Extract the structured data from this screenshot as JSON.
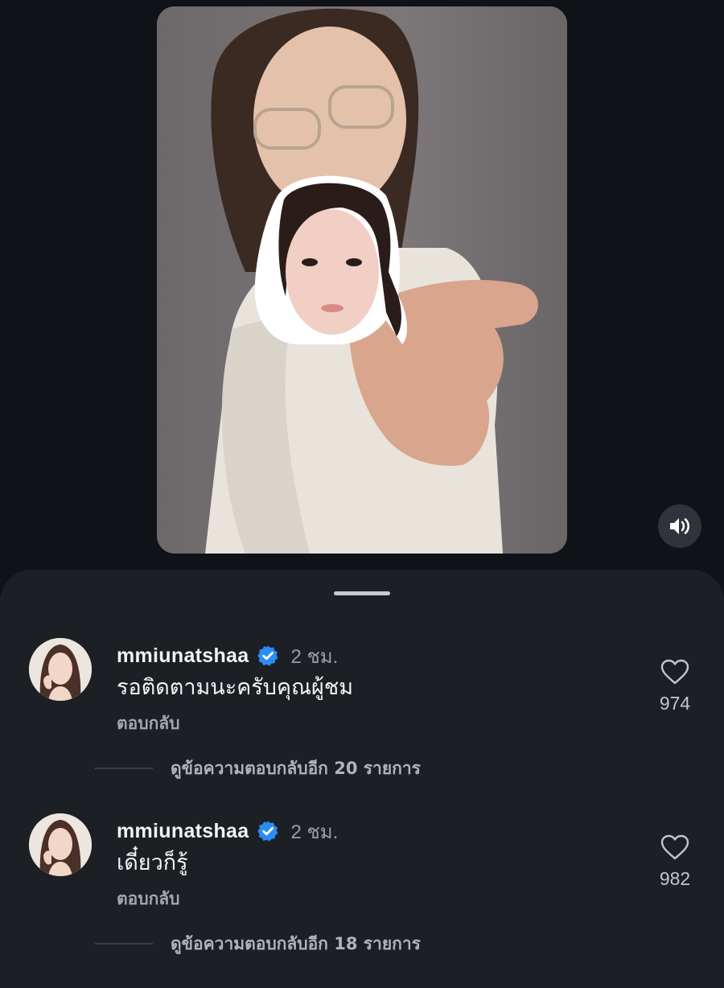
{
  "video": {
    "sound_icon": "speaker-volume-icon"
  },
  "comments": [
    {
      "username": "mmiunatshaa",
      "verified": true,
      "time": "2 ชม.",
      "text": "รอติดตามนะครับคุณผู้ชม",
      "reply_label": "ตอบกลับ",
      "likes": "974",
      "view_replies": "ดูข้อความตอบกลับอีก 20 รายการ"
    },
    {
      "username": "mmiunatshaa",
      "verified": true,
      "time": "2 ชม.",
      "text": "เดี๋ยวก็รู้",
      "reply_label": "ตอบกลับ",
      "likes": "982",
      "view_replies": "ดูข้อความตอบกลับอีก 18 รายการ"
    }
  ],
  "colors": {
    "background": "#0f1216",
    "sheet": "#1c1f23",
    "verified": "#2a8cf5"
  }
}
